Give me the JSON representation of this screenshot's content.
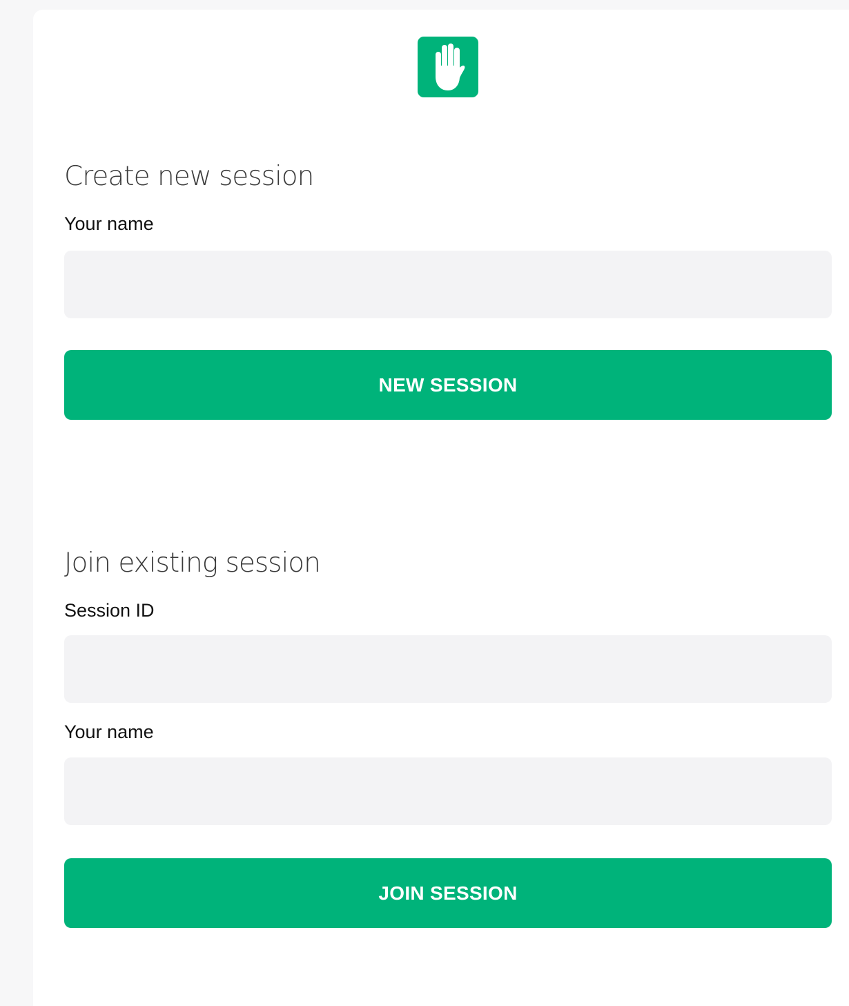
{
  "app": {
    "logo_icon": "raised-hand-icon",
    "accent_color": "#00b37a"
  },
  "create_section": {
    "title": "Create new session",
    "name_label": "Your name",
    "name_value": "",
    "name_placeholder": "",
    "button_label": "NEW SESSION"
  },
  "join_section": {
    "title": "Join existing session",
    "session_id_label": "Session ID",
    "session_id_value": "",
    "session_id_placeholder": "",
    "name_label": "Your name",
    "name_value": "",
    "name_placeholder": "",
    "button_label": "JOIN SESSION"
  }
}
